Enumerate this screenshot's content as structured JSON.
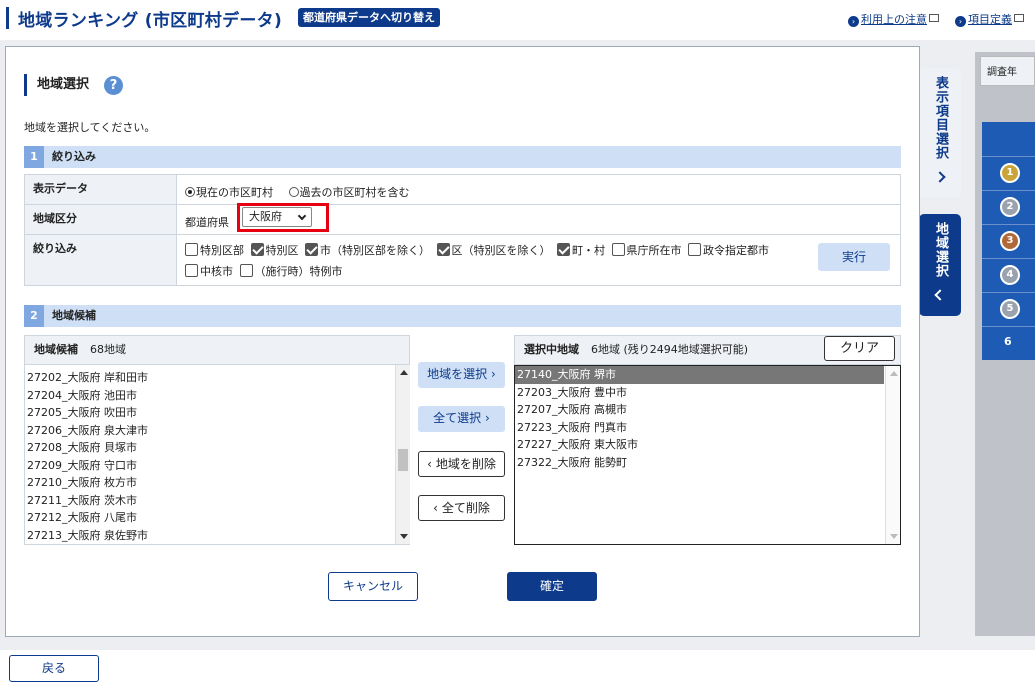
{
  "header": {
    "title": "地域ランキング (市区町村データ)",
    "switch_label": "都道府県データへ切り替え",
    "link_notes": "利用上の注意",
    "link_defs": "項目定義"
  },
  "section": {
    "title": "地域選択",
    "help_glyph": "?",
    "instruction": "地域を選択してください。"
  },
  "filter": {
    "band_num": "1",
    "band_label": "絞り込み",
    "display_label": "表示データ",
    "radio_current": "現在の市区町村",
    "radio_past": "過去の市区町村を含む",
    "area_label": "地域区分",
    "pref_label": "都道府県",
    "pref_value": "大阪府",
    "narrow_label": "絞り込み",
    "checks": [
      {
        "label": "特別区部",
        "checked": false
      },
      {
        "label": "特別区",
        "checked": true
      },
      {
        "label": "市（特別区部を除く）",
        "checked": true
      },
      {
        "label": "区（特別区を除く）",
        "checked": true
      },
      {
        "label": "町・村",
        "checked": true
      },
      {
        "label": "県庁所在市",
        "checked": false
      },
      {
        "label": "政令指定都市",
        "checked": false
      },
      {
        "label": "中核市",
        "checked": false
      },
      {
        "label": "（施行時）特例市",
        "checked": false
      }
    ],
    "exec_label": "実行"
  },
  "candidates": {
    "band_num": "2",
    "band_label": "地域候補",
    "title": "地域候補",
    "count": "68地域",
    "items": [
      "27202_大阪府 岸和田市",
      "27204_大阪府 池田市",
      "27205_大阪府 吹田市",
      "27206_大阪府 泉大津市",
      "27208_大阪府 貝塚市",
      "27209_大阪府 守口市",
      "27210_大阪府 枚方市",
      "27211_大阪府 茨木市",
      "27212_大阪府 八尾市",
      "27213_大阪府 泉佐野市"
    ]
  },
  "buttons": {
    "select": "地域を選択",
    "select_all": "全て選択",
    "remove": "地域を削除",
    "remove_all": "全て削除",
    "clear": "クリア",
    "cancel": "キャンセル",
    "ok": "確定",
    "back": "戻る"
  },
  "selected": {
    "title": "選択中地域",
    "count": "6地域",
    "remaining": "(残り2494地域選択可能)",
    "items": [
      "27140_大阪府 堺市",
      "27203_大阪府 豊中市",
      "27207_大阪府 高槻市",
      "27223_大阪府 門真市",
      "27227_大阪府 東大阪市",
      "27322_大阪府 能勢町"
    ]
  },
  "side_tabs": {
    "display_items": "表示項目選択",
    "region_select": "地域選択"
  },
  "right_panel": {
    "header": "調査年",
    "ranks": [
      "1",
      "2",
      "3",
      "4",
      "5",
      "6"
    ]
  },
  "colors": {
    "brand": "#0d3a8a",
    "band": "#cfe0f6",
    "highlight": "#e60012"
  }
}
